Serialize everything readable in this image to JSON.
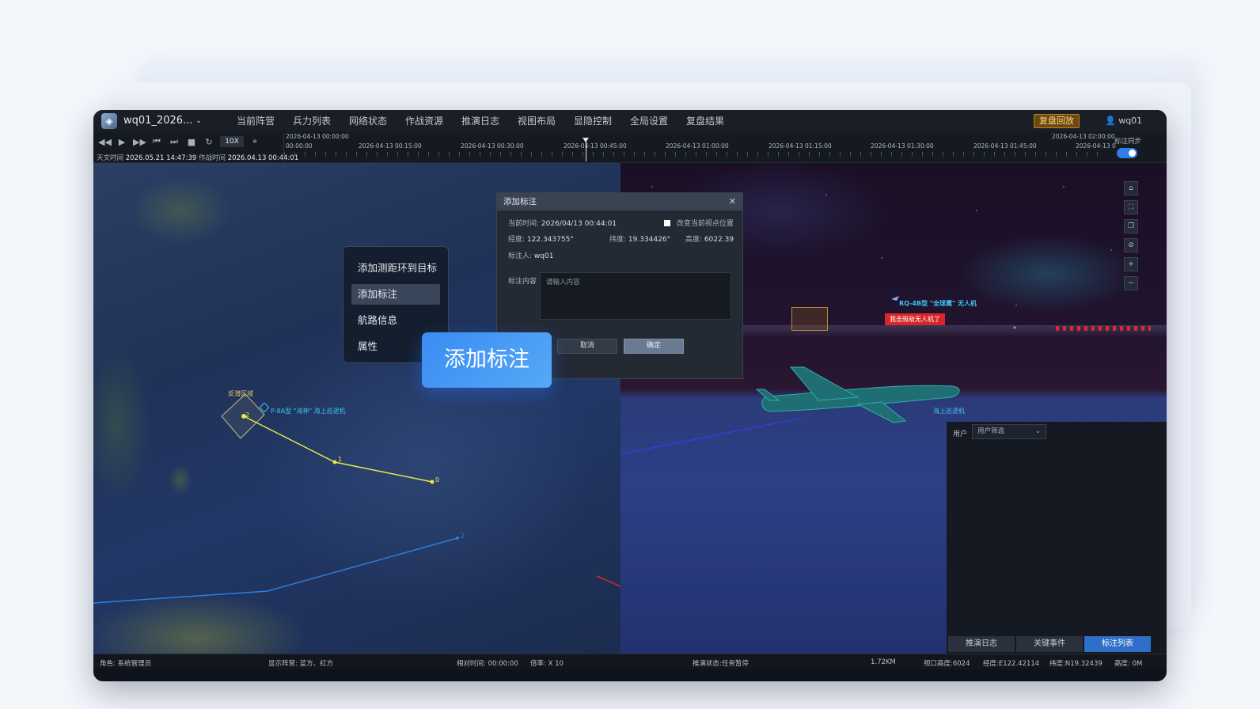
{
  "app": {
    "project": "wq01_2026...",
    "menu": [
      "当前阵营",
      "兵力列表",
      "网络状态",
      "作战资源",
      "推演日志",
      "视图布局",
      "显隐控制",
      "全局设置",
      "复盘结果"
    ],
    "replay_button": "复盘回放",
    "user": "wq01"
  },
  "toolbar": {
    "speed": "10X",
    "astro_time_label": "天文时间",
    "astro_time": "2026.05.21 14:47:39",
    "battle_time_label": "作战时间",
    "battle_time": "2026.04.13 00:44:01",
    "sync_label": "标注同步",
    "sync_on": true
  },
  "timeline": {
    "start": "2026-04-13 00:00:00",
    "end": "2026-04-13 02:00:00",
    "ticks": [
      "00:00:00",
      "2026-04-13 00:15:00",
      "2026-04-13 00:30:00",
      "2026-04-13 00:45:00",
      "2026-04-13 01:00:00",
      "2026-04-13 01:15:00",
      "2026-04-13 01:30:00",
      "2026-04-13 01:45:00",
      "2026-04-13 0"
    ]
  },
  "map": {
    "zone_label": "反潜区域",
    "track_label": "P-8A型 \"海神\" 海上巡逻机",
    "waypoints": [
      "2",
      "1",
      "0",
      "2"
    ]
  },
  "scene": {
    "drone_label": "RQ-4B型 \"全球鹰\" 无人机",
    "alert_label": "我击毁敌无人机了",
    "aircraft_label": "海上巡逻机"
  },
  "context_menu": {
    "items": [
      "添加测距环到目标",
      "添加标注",
      "航路信息",
      "属性"
    ],
    "selected": 1
  },
  "tooltip": "添加标注",
  "dialog": {
    "title": "添加标注",
    "current_time_label": "当前时间:",
    "current_time": "2026/04/13 00:44:01",
    "change_view_label": "改变当前视点位置",
    "longitude_label": "经度:",
    "longitude": "122.343755°",
    "latitude_label": "纬度:",
    "latitude": "19.334426°",
    "altitude_label": "高度:",
    "altitude": "6022.39",
    "annotator_label": "标注人:",
    "annotator": "wq01",
    "content_label": "标注内容",
    "content_placeholder": "请输入内容",
    "cancel": "取消",
    "ok": "确定"
  },
  "side_panel": {
    "user_label": "用户",
    "user_filter": "用户筛选",
    "tabs": [
      "推演日志",
      "关键事件",
      "标注列表"
    ],
    "active_tab": 2
  },
  "status": {
    "role": "角色: 系统管理员",
    "camp": "显示阵营: 蓝方、红方",
    "relative_time": "相对时间:    00:00:00",
    "rate": "倍率: X 10",
    "state": "推演状态:任务暂停",
    "scale": "1.72KM",
    "view_height": "视口高度:6024",
    "longitude": "经度:E122.42114",
    "latitude": "纬度:N19.32439",
    "altitude": "高度: 0M"
  },
  "colors": {
    "accent": "#2f6fc8",
    "track_yellow": "#e6e84a",
    "track_blue": "#2a7fe0",
    "label_cyan": "#3fc4f0",
    "alert_red": "#d8262a"
  }
}
